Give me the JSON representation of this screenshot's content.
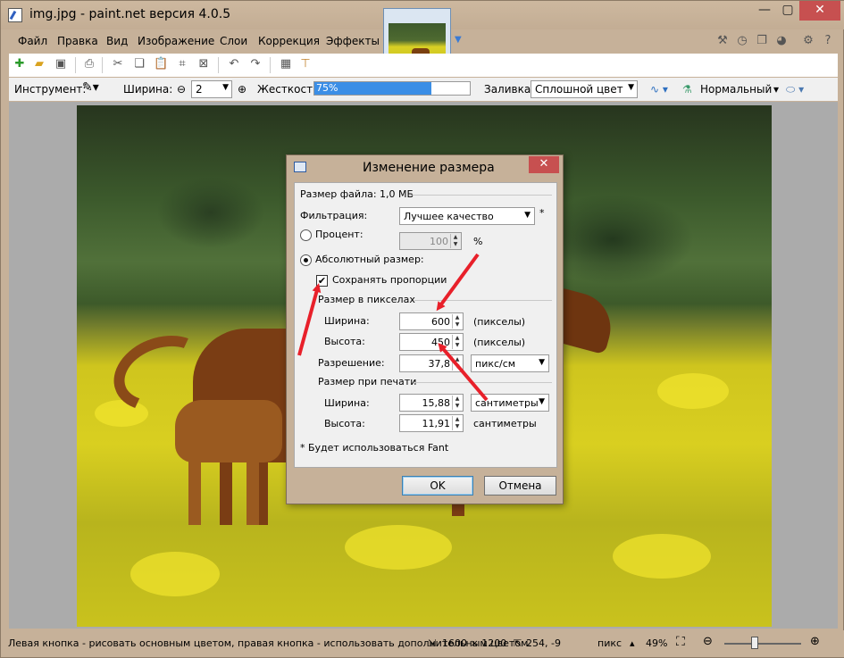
{
  "window": {
    "title": "img.jpg - paint.net версия 4.0.5",
    "min": "—",
    "max": "▢",
    "close": "✕"
  },
  "menu": [
    "Файл",
    "Правка",
    "Вид",
    "Изображение",
    "Слои",
    "Коррекция",
    "Эффекты"
  ],
  "toolbar2": {
    "tool_label": "Инструмент:",
    "width_label": "Ширина:",
    "width_value": "2",
    "hardness_label": "Жесткость:",
    "hardness_value": "75%",
    "hardness_level": 0.75,
    "fill_label": "Заливка:",
    "fill_value": "Сплошной цвет",
    "blend_value": "Нормальный"
  },
  "dialog": {
    "title": "Изменение размера",
    "filesize": "Размер файла: 1,0 МБ",
    "filter_label": "Фильтрация:",
    "filter_value": "Лучшее качество",
    "filter_star": "*",
    "percent_label": "Процент:",
    "percent_value": "100",
    "percent_unit": "%",
    "abs_label": "Абсолютный размер:",
    "keep_ratio": "Сохранять пропорции",
    "pixel_group": "Размер в пикселах",
    "width_label": "Ширина:",
    "width_value": "600",
    "width_unit": "(пикселы)",
    "height_label": "Высота:",
    "height_value": "450",
    "height_unit": "(пикселы)",
    "res_label": "Разрешение:",
    "res_value": "37,8",
    "res_unit": "пикс/см",
    "print_group": "Размер при печати",
    "pwidth_label": "Ширина:",
    "pwidth_value": "15,88",
    "pwidth_unit": "сантиметры",
    "pheight_label": "Высота:",
    "pheight_value": "11,91",
    "pheight_unit": "сантиметры",
    "note": "* Будет использоваться Fant",
    "ok": "OK",
    "cancel": "Отмена",
    "close": "✕"
  },
  "status": {
    "hint": "Левая кнопка - рисовать основным цветом, правая кнопка - использовать дополнительным цветом.",
    "image_size": "1600 × 1200",
    "cursor": "254, -9",
    "unit": "пикс",
    "zoom": "49%"
  },
  "colors": {
    "accent": "#3b8ee6",
    "arrow": "#e8202a",
    "close": "#c75050"
  }
}
